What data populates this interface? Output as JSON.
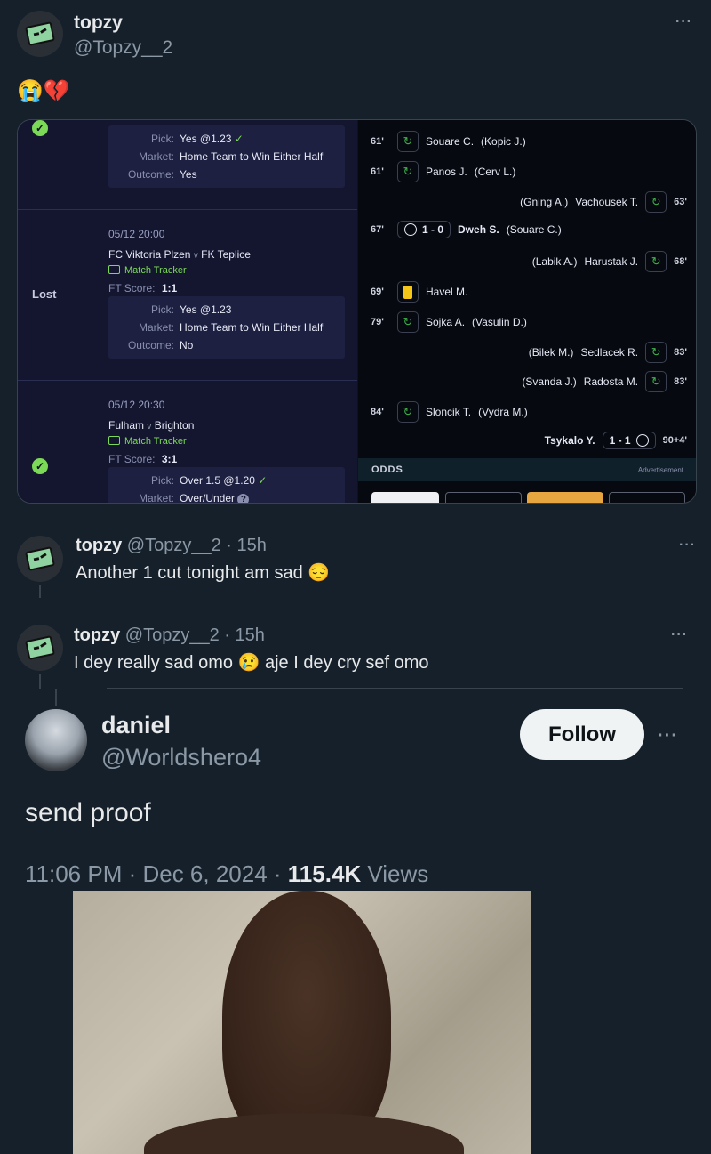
{
  "tweet1": {
    "name": "topzy",
    "handle": "@Topzy__2",
    "text": "😭💔",
    "more": "···"
  },
  "slip": {
    "rows": [
      {
        "status": "",
        "pick_label": "Pick:",
        "pick": "Yes @1.23",
        "market_label": "Market:",
        "market": "Home Team to Win Either Half",
        "outcome_label": "Outcome:",
        "outcome": "Yes"
      },
      {
        "status": "Lost",
        "datetime": "05/12 20:00",
        "home": "FC Viktoria Plzen",
        "vs": "v",
        "away": "FK Teplice",
        "tracker": "Match Tracker",
        "ft_label": "FT Score:",
        "ft": "1:1",
        "pick_label": "Pick:",
        "pick": "Yes @1.23",
        "market_label": "Market:",
        "market": "Home Team to Win Either Half",
        "outcome_label": "Outcome:",
        "outcome": "No"
      },
      {
        "status": "",
        "datetime": "05/12 20:30",
        "home": "Fulham",
        "vs": "v",
        "away": "Brighton",
        "tracker": "Match Tracker",
        "ft_label": "FT Score:",
        "ft": "3:1",
        "pick_label": "Pick:",
        "pick": "Over 1.5 @1.20",
        "market_label": "Market:",
        "market": "Over/Under"
      }
    ],
    "events": [
      {
        "min": "61'",
        "side": "left",
        "type": "sub",
        "player": "Souare C.",
        "assist": "(Kopic J.)"
      },
      {
        "min": "61'",
        "side": "left",
        "type": "sub",
        "player": "Panos J.",
        "assist": "(Cerv L.)"
      },
      {
        "min": "63'",
        "side": "right",
        "type": "sub",
        "player": "Vachousek T.",
        "assist": "(Gning A.)"
      },
      {
        "min": "67'",
        "side": "left",
        "type": "goal",
        "score": "1 - 0",
        "player": "Dweh S.",
        "assist": "(Souare C.)"
      },
      {
        "min": "68'",
        "side": "right",
        "type": "sub",
        "player": "Harustak J.",
        "assist": "(Labik A.)"
      },
      {
        "min": "69'",
        "side": "left",
        "type": "yellow",
        "player": "Havel M.",
        "assist": ""
      },
      {
        "min": "79'",
        "side": "left",
        "type": "sub",
        "player": "Sojka A.",
        "assist": "(Vasulin D.)"
      },
      {
        "min": "83'",
        "side": "right",
        "type": "sub",
        "player": "Sedlacek R.",
        "assist": "(Bilek M.)"
      },
      {
        "min": "83'",
        "side": "right",
        "type": "sub",
        "player": "Radosta M.",
        "assist": "(Svanda J.)"
      },
      {
        "min": "84'",
        "side": "left",
        "type": "sub",
        "player": "Sloncik T.",
        "assist": "(Vydra M.)"
      },
      {
        "min": "90+4'",
        "side": "right",
        "type": "goal",
        "score": "1 - 1",
        "player": "Tsykalo Y.",
        "assist": ""
      }
    ],
    "odds_label": "ODDS",
    "ad_label": "Advertisement"
  },
  "tweet2": {
    "name": "topzy",
    "handle": "@Topzy__2",
    "time": "15h",
    "text": "Another 1 cut tonight am sad 😔"
  },
  "tweet3": {
    "name": "topzy",
    "handle": "@Topzy__2",
    "time": "15h",
    "text": "I dey really sad omo 😢 aje I dey cry sef omo"
  },
  "tweet4": {
    "name": "daniel",
    "handle": "@Worldshero4",
    "follow": "Follow",
    "text": "send proof",
    "timestamp": "11:06 PM · Dec 6, 2024 · ",
    "views": "115.4K",
    "views_label": " Views"
  },
  "colors": {
    "background": "#15202b",
    "muted": "#8b98a5",
    "green": "#7bd957"
  }
}
